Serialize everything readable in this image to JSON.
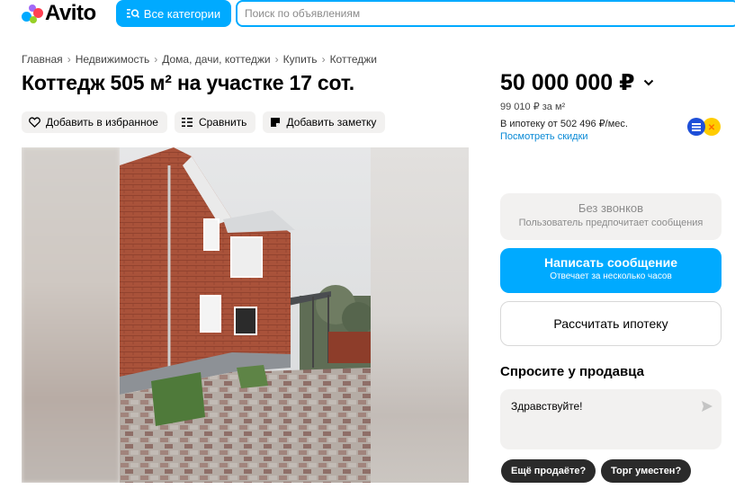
{
  "header": {
    "logo_text": "Avito",
    "categories_label": "Все категории",
    "search_placeholder": "Поиск по объявлениям",
    "accent_color": "#00aaff"
  },
  "breadcrumbs": [
    "Главная",
    "Недвижимость",
    "Дома, дачи, коттеджи",
    "Купить",
    "Коттеджи"
  ],
  "listing": {
    "title": "Коттедж 505 м² на участке 17 сот.",
    "actions": [
      {
        "label": "Добавить в избранное",
        "icon": "heart-icon"
      },
      {
        "label": "Сравнить",
        "icon": "compare-icon"
      },
      {
        "label": "Добавить заметку",
        "icon": "note-icon"
      }
    ]
  },
  "pricing": {
    "price": "50 000 000 ₽",
    "price_per_sqm": "99 010 ₽ за м²",
    "mortgage_text": "В ипотеку от 502 496 ₽/мес.",
    "discounts_link": "Посмотреть скидки"
  },
  "contact": {
    "no_calls_title": "Без звонков",
    "no_calls_subtitle": "Пользователь предпочитает сообщения",
    "write_title": "Написать сообщение",
    "write_subtitle": "Отвечает за несколько часов",
    "calc_mortgage": "Рассчитать ипотеку"
  },
  "ask_seller": {
    "title": "Спросите у продавца",
    "message": "Здравствуйте!",
    "quick_replies": [
      "Ещё продаёте?",
      "Торг уместен?"
    ]
  }
}
